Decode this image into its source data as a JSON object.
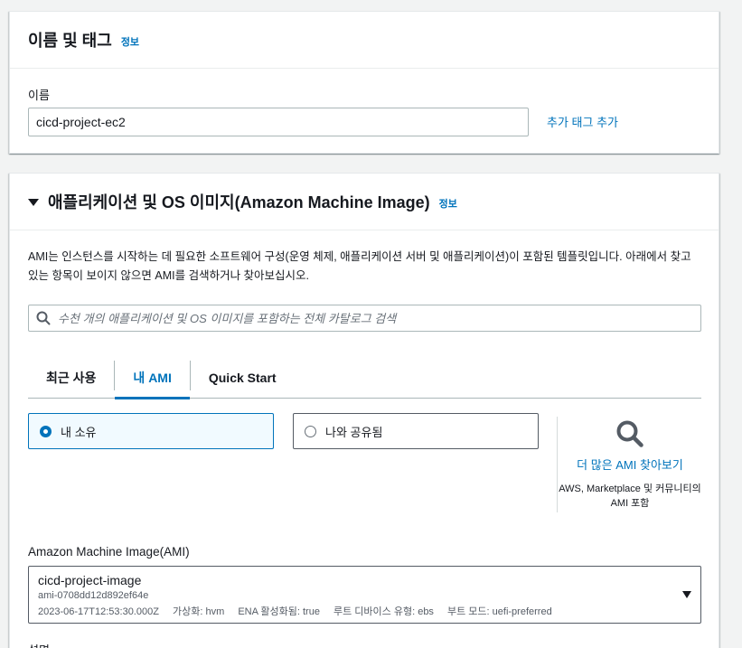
{
  "name_section": {
    "title": "이름 및 태그",
    "info": "정보",
    "name_label": "이름",
    "name_value": "cicd-project-ec2",
    "add_tags": "추가 태그 추가"
  },
  "ami_section": {
    "title": "애플리케이션 및 OS 이미지(Amazon Machine Image)",
    "info": "정보",
    "description": "AMI는 인스턴스를 시작하는 데 필요한 소프트웨어 구성(운영 체제, 애플리케이션 서버 및 애플리케이션)이 포함된 템플릿입니다. 아래에서 찾고 있는 항목이 보이지 않으면 AMI를 검색하거나 찾아보십시오.",
    "search_placeholder": "수천 개의 애플리케이션 및 OS 이미지를 포함하는 전체 카탈로그 검색",
    "tabs": [
      {
        "label": "최근 사용",
        "active": false
      },
      {
        "label": "내 AMI",
        "active": true
      },
      {
        "label": "Quick Start",
        "active": false
      }
    ],
    "radio_owned": "내 소유",
    "radio_shared": "나와 공유됨",
    "selected_radio": "owned",
    "browse_link": "더 많은 AMI 찾아보기",
    "browse_desc": "AWS, Marketplace 및 커뮤니티의 AMI 포함",
    "ami_label": "Amazon Machine Image(AMI)",
    "ami": {
      "name": "cicd-project-image",
      "id": "ami-0708dd12d892ef64e",
      "date": "2023-06-17T12:53:30.000Z",
      "virtualization": "가상화: hvm",
      "ena": "ENA 활성화됨: true",
      "root_device": "루트 디바이스 유형: ebs",
      "boot_mode": "부트 모드: uefi-preferred"
    },
    "next_label": "설명"
  },
  "icons": {
    "search": "search-icon",
    "magnifier": "magnifier-icon",
    "caret": "caret-down-icon"
  },
  "colors": {
    "link": "#0073bb",
    "selected_bg": "#f1faff",
    "text": "#16191f"
  }
}
